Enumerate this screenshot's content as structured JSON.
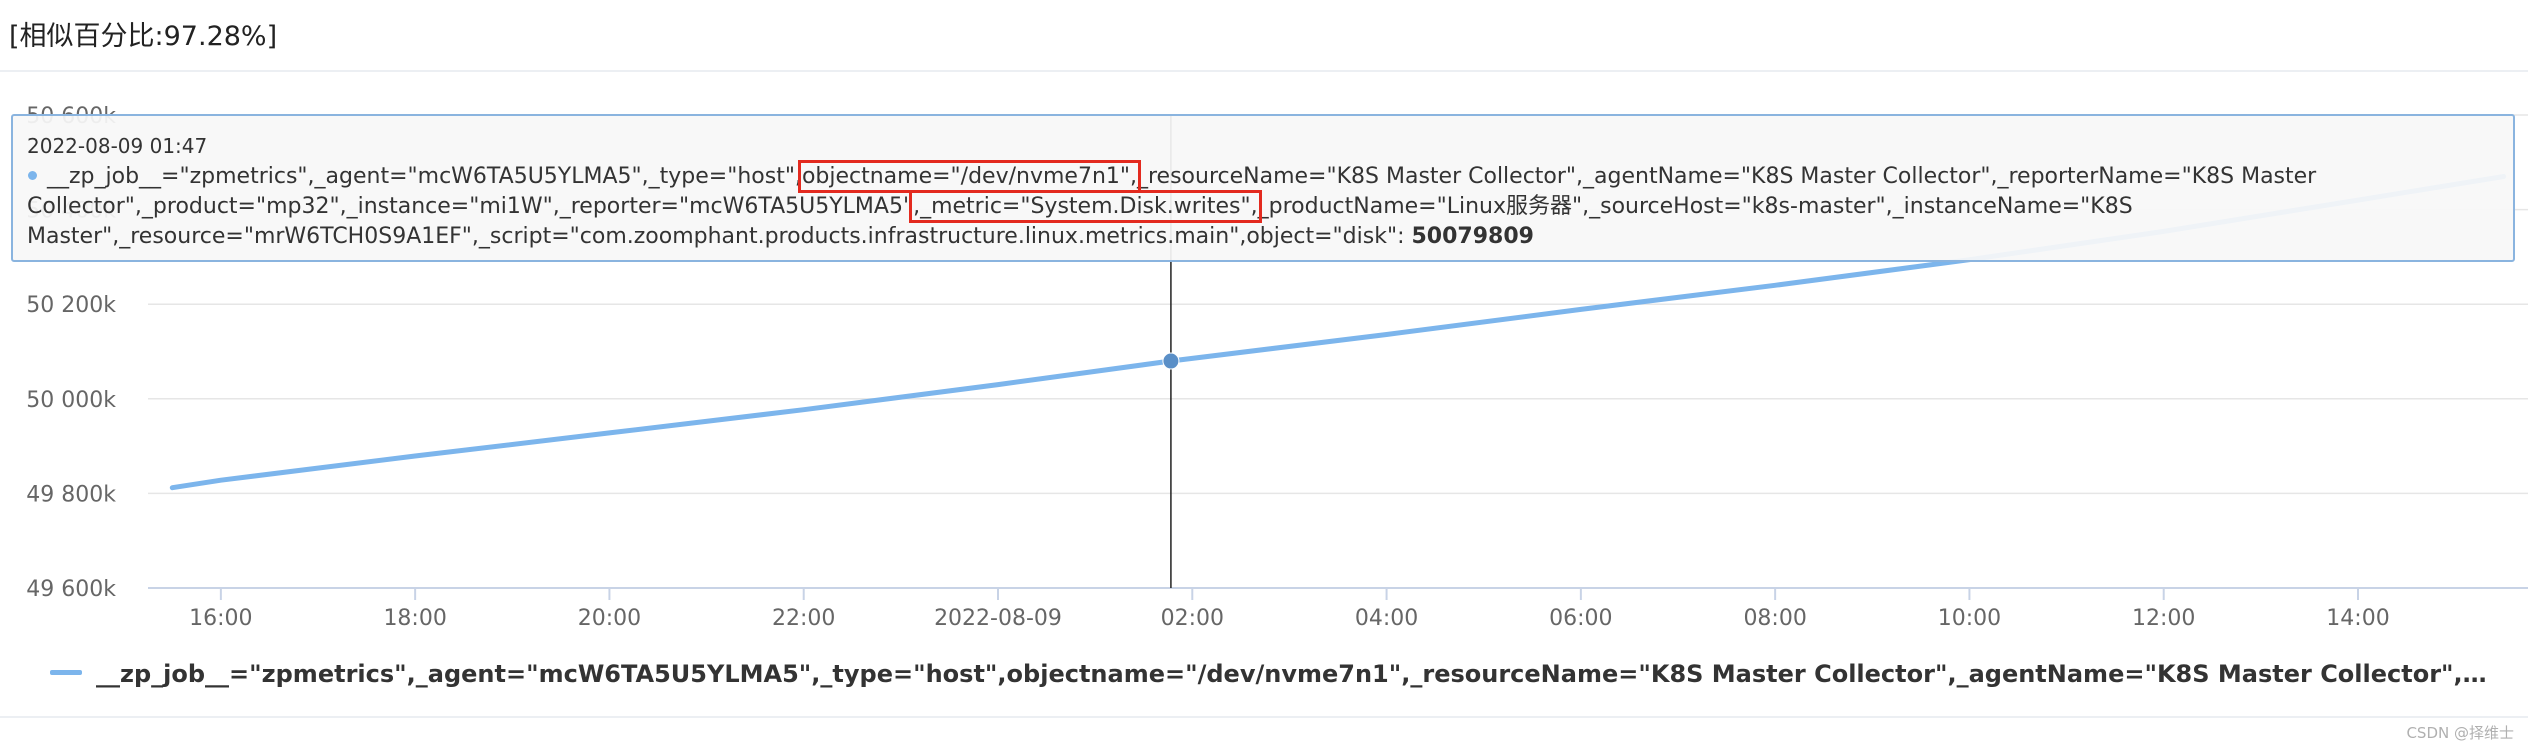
{
  "header": {
    "similarity": "[相似百分比:97.28%]"
  },
  "tooltip": {
    "time": "2022-08-09 01:47",
    "parts": [
      "__zp_job__=\"zpmetrics\",_agent=\"mcW6TA5U5YLMA5\",_type=\"host\",",
      "objectname=\"/dev/nvme7n1\",",
      "_resourceName=\"K8S Master Collector\",_agentName=\"K8S Master Collector\",_reporterName=\"K8S Master Collector\",_product=\"mp32\",_instance=\"mi1W\",_reporter=\"mcW6TA5U5YLMA5\"",
      ",_metric=\"System.Disk.writes\",",
      "_productName=\"Linux服务器\",_sourceHost=\"k8s-master\",_instanceName=\"K8S Master\",_resource=\"mrW6TCH0S9A1EF\",_script=\"com.zoomphant.products.infrastructure.linux.metrics.main\",object=\"disk\": "
    ],
    "value": "50079809"
  },
  "legend": {
    "label": "__zp_job__=\"zpmetrics\",_agent=\"mcW6TA5U5YLMA5\",_type=\"host\",objectname=\"/dev/nvme7n1\",_resourceName=\"K8S Master Collector\",_agentName=\"K8S Master Collector\",_reporterName=\"K8S Master Collector\",_product=\"mp32\",_instance=\"mi1W\",_reporter=\"mcW6TA5U5YLMA5\",_metric=\"System.Disk.writes\",_productName=\"Linux服务器\",_sourceHost=\"k8s-master\",_instanceName=\"K8S Master\",_resource=\"mrW6TCH0S9A1EF\",_script=\"com.zoomphant.products.infrastructure.linux.metrics.main\",object=\"disk\""
  },
  "watermark": "CSDN @择维士",
  "colors": {
    "series": "#7cb5ec",
    "highlight": "#e32a1f",
    "grid": "#e6e6e6"
  },
  "chart_data": {
    "type": "line",
    "title": "",
    "xlabel": "",
    "ylabel": "",
    "x_ticks": [
      "16:00",
      "18:00",
      "20:00",
      "22:00",
      "2022-08-09",
      "02:00",
      "04:00",
      "06:00",
      "08:00",
      "10:00",
      "12:00",
      "14:00"
    ],
    "x_tick_hours": [
      16,
      18,
      20,
      22,
      24,
      26,
      28,
      30,
      32,
      34,
      36,
      38
    ],
    "y_ticks": [
      "49 600k",
      "49 800k",
      "50 000k",
      "50 200k",
      "50 400k",
      "50 600k"
    ],
    "y_tick_values": [
      49600,
      49800,
      50000,
      50200,
      50400,
      50600
    ],
    "ylim": [
      49600,
      50600
    ],
    "xlim_hours": [
      15.25,
      39.75
    ],
    "grid": true,
    "legend_position": "bottom",
    "series": [
      {
        "name": "__zp_job__=\"zpmetrics\",_agent=\"mcW6TA5U5YLMA5\",_type=\"host\",objectname=\"/dev/nvme7n1\",_resourceName=\"K8S Master Collector\",_agentName=\"K8S Master Collector\",_reporterName=\"K8S Master Collector\",_product=\"mp32\",_instance=\"mi1W\",_reporter=\"mcW6TA5U5YLMA5\",_metric=\"System.Disk.writes\",_productName=\"Linux服务器\",_sourceHost=\"k8s-master\",_instanceName=\"K8S Master\",_resource=\"mrW6TCH0S9A1EF\",_script=\"com.zoomphant.products.infrastructure.linux.metrics.main\",object=\"disk\"",
        "hours": [
          15.5,
          16,
          18,
          20,
          22,
          24,
          25.78,
          28,
          30,
          32,
          34,
          36,
          38,
          39.5
        ],
        "values": [
          49812,
          49828,
          49879,
          49928,
          49977,
          50030,
          50080,
          50136,
          50189,
          50240,
          50294,
          50354,
          50420,
          50470
        ]
      }
    ],
    "crosshair": {
      "hour": 25.78,
      "value": 50079.809
    }
  }
}
